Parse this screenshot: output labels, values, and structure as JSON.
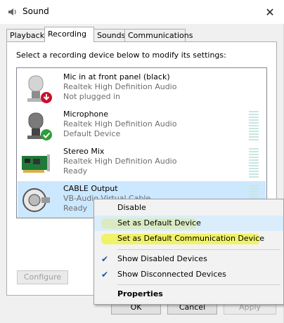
{
  "window": {
    "title": "Sound",
    "close_glyph": "✕"
  },
  "tabs": [
    {
      "label": "Playback"
    },
    {
      "label": "Recording"
    },
    {
      "label": "Sounds"
    },
    {
      "label": "Communications"
    }
  ],
  "instruction": "Select a recording device below to modify its settings:",
  "devices": [
    {
      "name": "Mic in at front panel (black)",
      "driver": "Realtek High Definition Audio",
      "status": "Not plugged in",
      "icon": "microphone-icon",
      "badge": "red-down-arrow"
    },
    {
      "name": "Microphone",
      "driver": "Realtek High Definition Audio",
      "status": "Default Device",
      "icon": "microphone-icon",
      "badge": "green-check"
    },
    {
      "name": "Stereo Mix",
      "driver": "Realtek High Definition Audio",
      "status": "Ready",
      "icon": "sound-card-icon"
    },
    {
      "name": "CABLE Output",
      "driver": "VB-Audio Virtual Cable",
      "status": "Ready",
      "icon": "cable-icon"
    }
  ],
  "buttons": {
    "configure": "Configure",
    "ok": "OK",
    "cancel": "Cancel",
    "apply": "Apply"
  },
  "context_menu": {
    "items": [
      {
        "label": "Disable"
      },
      {
        "label": "Set as Default Device"
      },
      {
        "label": "Set as Default Communication Device"
      },
      {
        "label": "Show Disabled Devices",
        "checked": true
      },
      {
        "label": "Show Disconnected Devices",
        "checked": true
      },
      {
        "label": "Properties"
      }
    ]
  },
  "colors": {
    "selection": "#cce8ff",
    "highlighter": "#f0f03c",
    "check": "#1a56a0"
  }
}
